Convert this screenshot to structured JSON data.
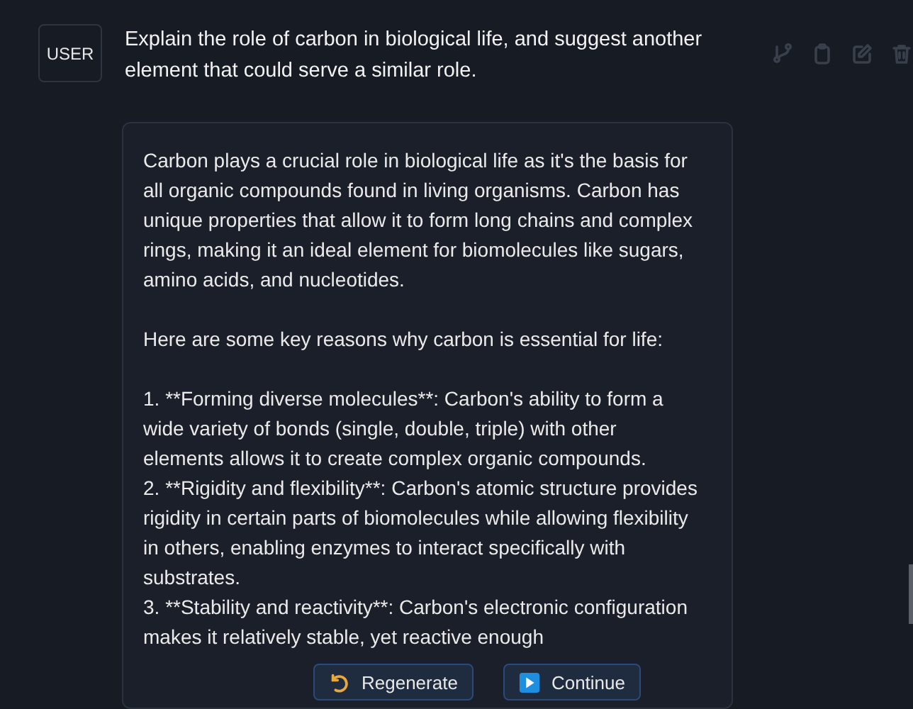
{
  "user_message": {
    "role": "USER",
    "text": "Explain the role of carbon in biological life, and suggest another element that could serve a similar role."
  },
  "response": {
    "blocks": [
      {
        "kind": "paragraph",
        "text": "Carbon plays a crucial role in biological life as it's the basis for all organic compounds found in living organisms. Carbon has unique properties that allow it to form long chains and complex rings, making it an ideal element for biomolecules like sugars, amino acids, and nucleotides."
      },
      {
        "kind": "paragraph",
        "text": "Here are some key reasons why carbon is essential for life:"
      },
      {
        "kind": "list",
        "items": [
          "1. **Forming diverse molecules**: Carbon's ability to form a wide variety of bonds (single, double, triple) with other elements allows it to create complex organic compounds.",
          "2. **Rigidity and flexibility**: Carbon's atomic structure provides rigidity in certain parts of biomolecules while allowing flexibility in others, enabling enzymes to interact specifically with substrates.",
          "3. **Stability and reactivity**: Carbon's electronic configuration makes it relatively stable, yet reactive enough"
        ]
      }
    ]
  },
  "actions": [
    {
      "kind": "regenerate",
      "label": "Regenerate"
    },
    {
      "kind": "continue",
      "label": "Continue"
    }
  ]
}
